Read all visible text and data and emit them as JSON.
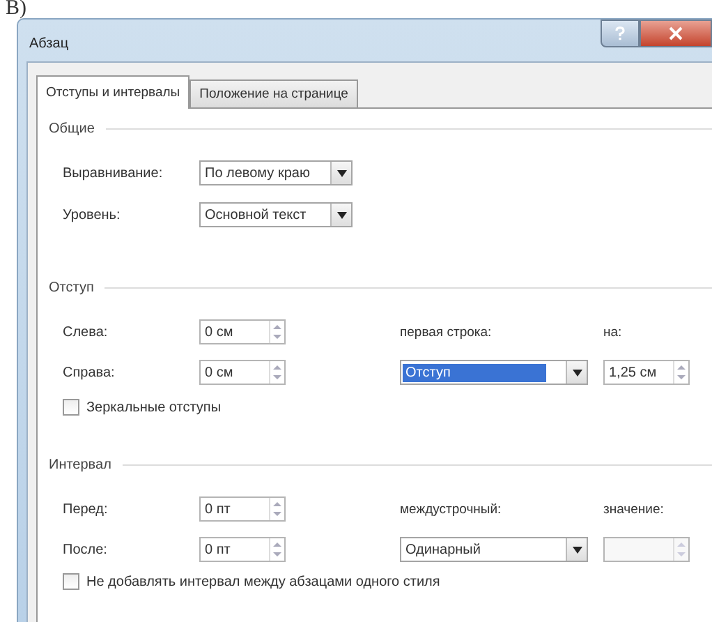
{
  "caption": "В)",
  "window": {
    "title": "Абзац"
  },
  "tabs": [
    {
      "label": "Отступы и интервалы",
      "selected": true
    },
    {
      "label": "Положение на странице",
      "selected": false
    }
  ],
  "general": {
    "title": "Общие",
    "alignment": {
      "label": "Выравнивание:",
      "value": "По левому краю"
    },
    "level": {
      "label": "Уровень:",
      "value": "Основной текст"
    }
  },
  "indent": {
    "title": "Отступ",
    "left": {
      "label": "Слева:",
      "value": "0 см"
    },
    "right": {
      "label": "Справа:",
      "value": "0 см"
    },
    "first_line": {
      "label": "первая строка:",
      "value": "Отступ",
      "selected": true
    },
    "by": {
      "label": "на:",
      "value": "1,25 см"
    },
    "mirror": {
      "label": "Зеркальные отступы",
      "checked": false
    }
  },
  "spacing": {
    "title": "Интервал",
    "before": {
      "label": "Перед:",
      "value": "0 пт"
    },
    "after": {
      "label": "После:",
      "value": "0 пт"
    },
    "line": {
      "label": "междустрочный:",
      "value": "Одинарный",
      "selected": false
    },
    "at": {
      "label": "значение:"
    },
    "no_space": {
      "label": "Не добавлять интервал между абзацами одного стиля",
      "checked": false
    }
  }
}
